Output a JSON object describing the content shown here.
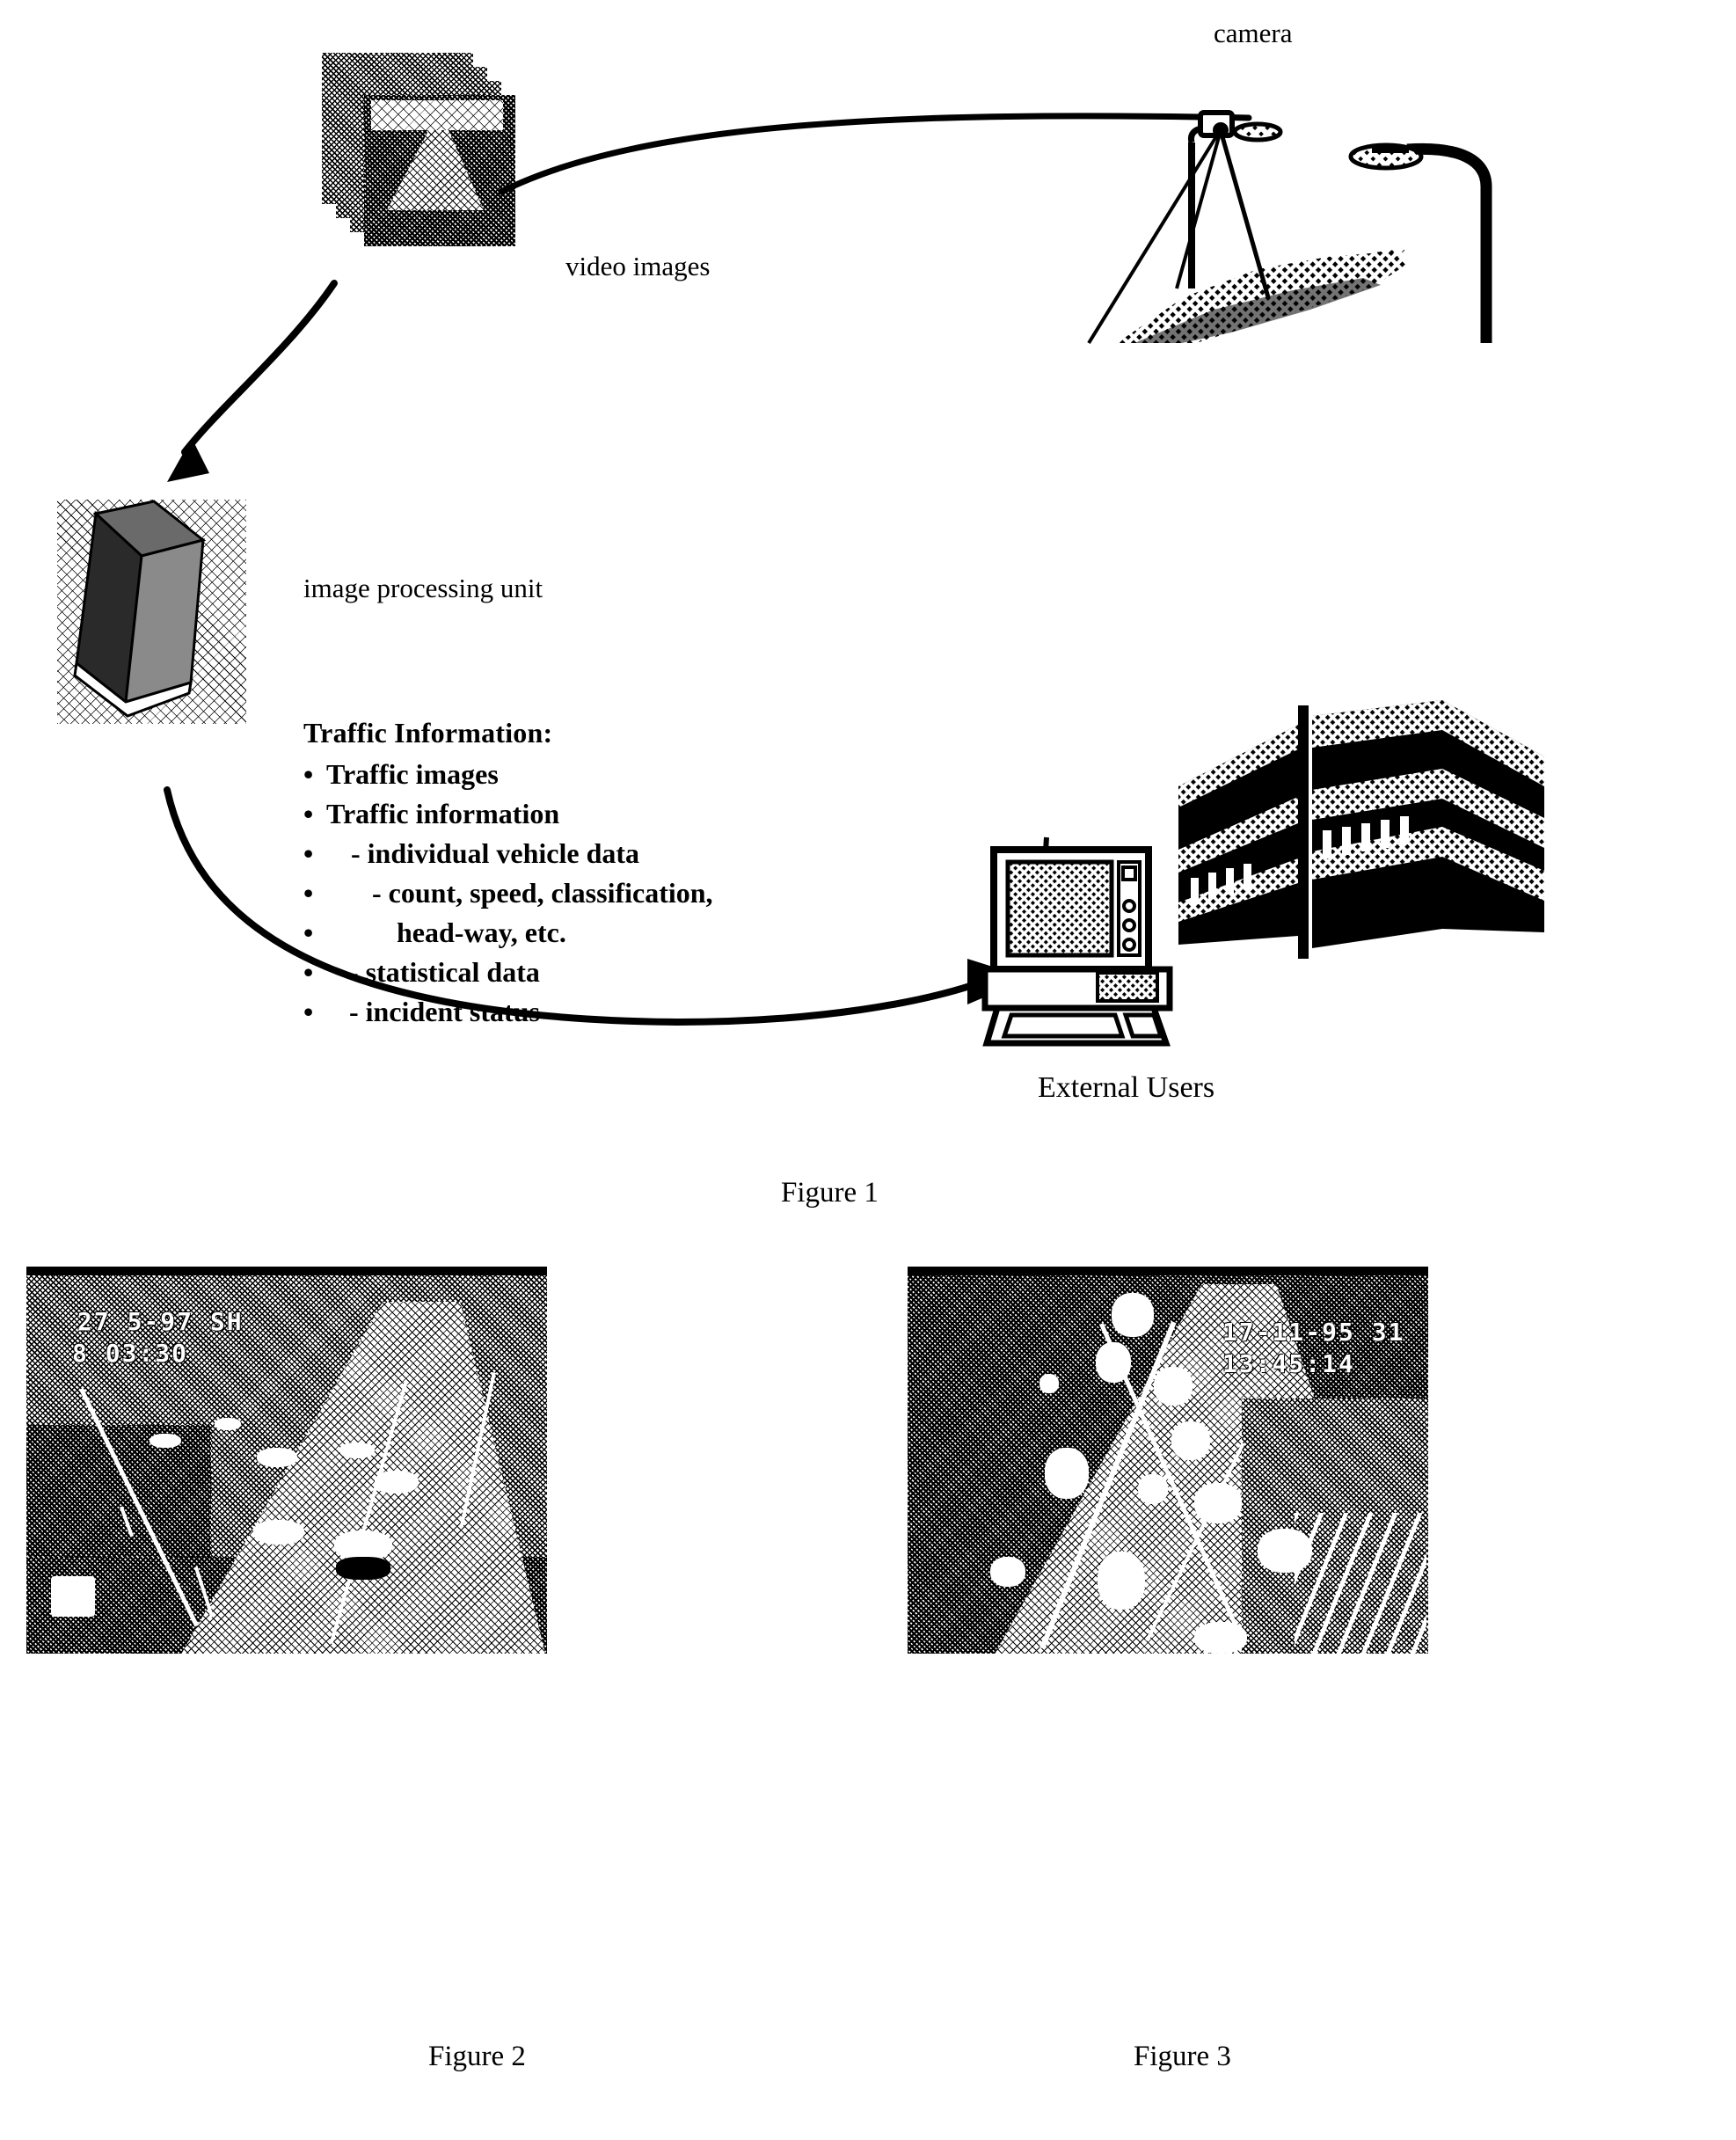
{
  "document": {
    "type": "patent-drawing-sheet",
    "figures": [
      "Figure 1",
      "Figure 2",
      "Figure 3"
    ]
  },
  "figure1": {
    "caption": "Figure 1",
    "labels": {
      "camera": "camera",
      "video_images": "video images",
      "image_processing_unit": "image processing unit",
      "external_users": "External Users"
    },
    "traffic_information": {
      "heading": "Traffic Information:",
      "items": [
        {
          "bullet": "•",
          "text": "Traffic images",
          "indent": 0
        },
        {
          "bullet": "•",
          "text": "Traffic information",
          "indent": 0
        },
        {
          "bullet": "•",
          "text": "- individual vehicle data",
          "indent": 1
        },
        {
          "bullet": "•",
          "text": "- count, speed, classification,",
          "indent": 2
        },
        {
          "bullet": "•",
          "text": "head-way, etc.",
          "indent": 3
        },
        {
          "bullet": "•",
          "text": "- statistical data",
          "indent": 1
        },
        {
          "bullet": "•",
          "text": "- incident status",
          "indent": 1
        }
      ]
    },
    "flow": {
      "arrow1": "video-images-to-camera-flow",
      "arrow2": "camera-to-image-processing-unit-flow",
      "arrow3": "image-processing-unit-to-external-users-flow"
    }
  },
  "figure2": {
    "caption": "Figure 2",
    "scene": "daytime highway traffic camera view",
    "overlay": {
      "line1": "27  5-97  SH",
      "line2": "8 03:30"
    }
  },
  "figure3": {
    "caption": "Figure 3",
    "scene": "night / processed highway traffic camera view with detected vehicle blobs",
    "overlay": {
      "line1": "17-11-95  31",
      "line2": "13:45:14"
    }
  },
  "colors": {
    "ink": "#000000",
    "paper": "#ffffff"
  }
}
